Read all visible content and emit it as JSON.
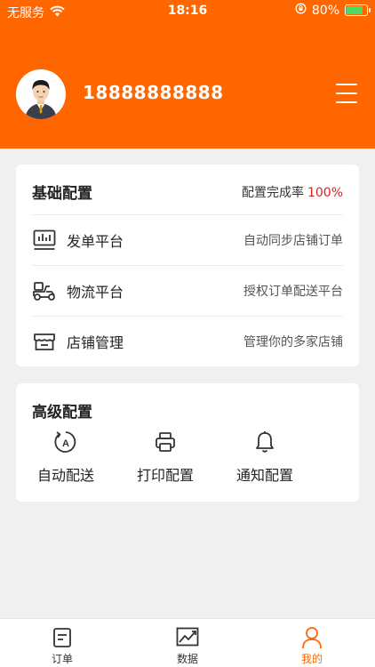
{
  "status_bar": {
    "carrier": "无服务",
    "time": "18:16",
    "battery": "80%"
  },
  "profile": {
    "phone": "18888888888"
  },
  "basic_config": {
    "title": "基础配置",
    "rate_label": "配置完成率",
    "rate_value": "100%",
    "items": [
      {
        "label": "发单平台",
        "desc": "自动同步店铺订单",
        "icon": "chart-icon"
      },
      {
        "label": "物流平台",
        "desc": "授权订单配送平台",
        "icon": "scooter-icon"
      },
      {
        "label": "店铺管理",
        "desc": "管理你的多家店铺",
        "icon": "store-icon"
      }
    ]
  },
  "advanced_config": {
    "title": "高级配置",
    "items": [
      {
        "label": "自动配送",
        "icon": "auto-refresh-icon"
      },
      {
        "label": "打印配置",
        "icon": "printer-icon"
      },
      {
        "label": "通知配置",
        "icon": "bell-icon"
      }
    ]
  },
  "tabbar": {
    "items": [
      {
        "label": "订单",
        "icon": "order-icon"
      },
      {
        "label": "数据",
        "icon": "data-chart-icon"
      },
      {
        "label": "我的",
        "icon": "profile-icon",
        "active": true
      }
    ]
  },
  "colors": {
    "brand": "#ff6600",
    "rate": "#e02020",
    "background": "#f0f0f0"
  }
}
